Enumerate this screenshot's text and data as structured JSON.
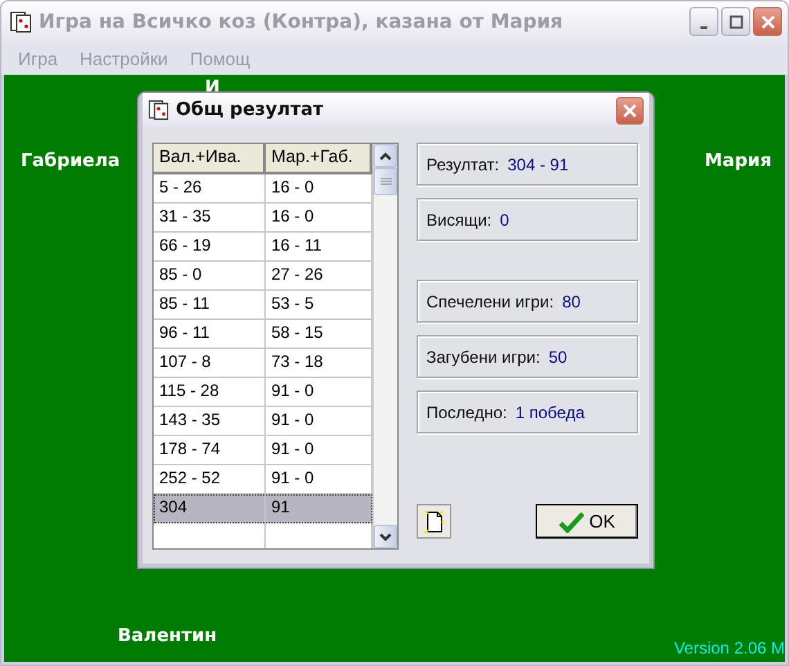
{
  "window": {
    "title": "Игра на Всичко коз (Контра), казана от Мария"
  },
  "menu": [
    "Игра",
    "Настройки",
    "Помощ"
  ],
  "players": {
    "top": "И",
    "left": "Габриела",
    "right": "Мария",
    "bottom": "Валентин"
  },
  "version": "Version 2.06 M",
  "dialog": {
    "title": "Общ резултат",
    "table": {
      "columns": [
        "Вал.+Ива.",
        "Мар.+Габ."
      ],
      "rows": [
        {
          "cells": [
            "5 - 26",
            "16 - 0"
          ],
          "selected": false
        },
        {
          "cells": [
            "31 - 35",
            "16 - 0"
          ],
          "selected": false
        },
        {
          "cells": [
            "66 - 19",
            "16 - 11"
          ],
          "selected": false
        },
        {
          "cells": [
            "85 - 0",
            "27 - 26"
          ],
          "selected": false
        },
        {
          "cells": [
            "85 - 11",
            "53 - 5"
          ],
          "selected": false
        },
        {
          "cells": [
            "96 - 11",
            "58 - 15"
          ],
          "selected": false
        },
        {
          "cells": [
            "107 - 8",
            "73 - 18"
          ],
          "selected": false
        },
        {
          "cells": [
            "115 - 28",
            "91 - 0"
          ],
          "selected": false
        },
        {
          "cells": [
            "143 - 35",
            "91 - 0"
          ],
          "selected": false
        },
        {
          "cells": [
            "178 - 74",
            "91 - 0"
          ],
          "selected": false
        },
        {
          "cells": [
            "252 - 52",
            "91 - 0"
          ],
          "selected": false
        },
        {
          "cells": [
            "304",
            "91"
          ],
          "selected": true
        }
      ]
    },
    "stats": [
      {
        "label": "Резултат:",
        "value": "304 - 91"
      },
      {
        "label": "Висящи:",
        "value": "0"
      }
    ],
    "game_stats": [
      {
        "label": "Спечелени игри:",
        "value": "80"
      },
      {
        "label": "Загубени игри:",
        "value": "50"
      },
      {
        "label": "Последно:",
        "value": "1 победа"
      }
    ],
    "ok_button": "OK"
  }
}
